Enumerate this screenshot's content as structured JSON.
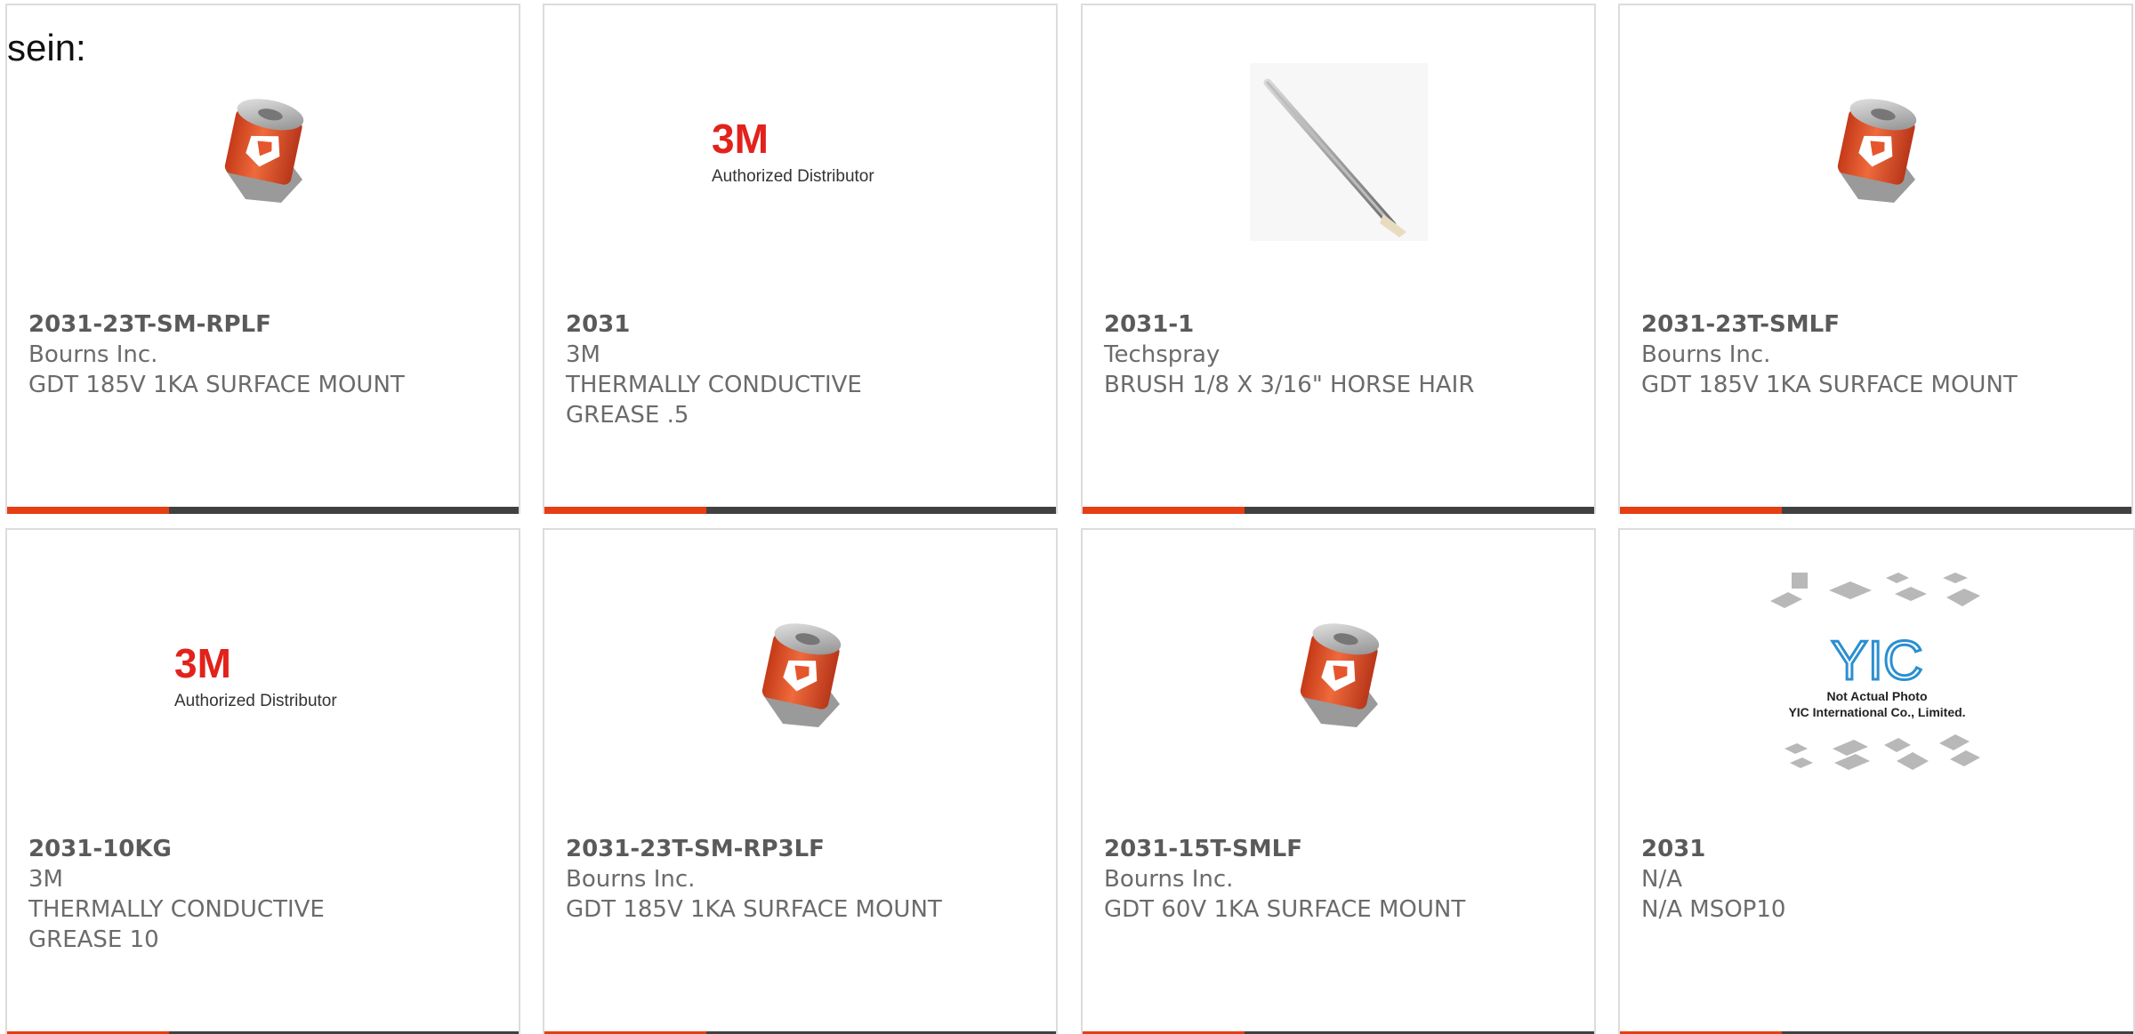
{
  "lead_text": "sein:",
  "colors": {
    "accent": "#e53e12",
    "bar_dark": "#414141",
    "card_border": "#dcdcdc",
    "text": "#6b6b6b"
  },
  "products": [
    {
      "part_number": "2031-23T-SM-RPLF",
      "manufacturer": "Bourns Inc.",
      "description": "GDT 185V 1KA SURFACE MOUNT",
      "image": "gdt-component-photo"
    },
    {
      "part_number": "2031",
      "manufacturer": "3M",
      "description": "THERMALLY CONDUCTIVE GREASE .5",
      "image": "3m-authorized-distributor-logo"
    },
    {
      "part_number": "2031-1",
      "manufacturer": "Techspray",
      "description": "BRUSH 1/8 X 3/16\" HORSE HAIR",
      "image": "brush-photo"
    },
    {
      "part_number": "2031-23T-SMLF",
      "manufacturer": "Bourns Inc.",
      "description": "GDT 185V 1KA SURFACE MOUNT",
      "image": "gdt-component-photo"
    },
    {
      "part_number": "2031-10KG",
      "manufacturer": "3M",
      "description": "THERMALLY CONDUCTIVE GREASE 10",
      "image": "3m-authorized-distributor-logo"
    },
    {
      "part_number": "2031-23T-SM-RP3LF",
      "manufacturer": "Bourns Inc.",
      "description": "GDT 185V 1KA SURFACE MOUNT",
      "image": "gdt-component-photo"
    },
    {
      "part_number": "2031-15T-SMLF",
      "manufacturer": "Bourns Inc.",
      "description": "GDT 60V 1KA SURFACE MOUNT",
      "image": "gdt-component-photo"
    },
    {
      "part_number": "2031",
      "manufacturer": "N/A",
      "description": "N/A MSOP10",
      "image": "yic-placeholder-image"
    }
  ],
  "logo_text": {
    "3m_brand": "3M",
    "3m_tagline": "Authorized Distributor",
    "yic_brand": "YIC",
    "yic_line1": "Not Actual Photo",
    "yic_line2": "YIC International Co., Limited."
  }
}
